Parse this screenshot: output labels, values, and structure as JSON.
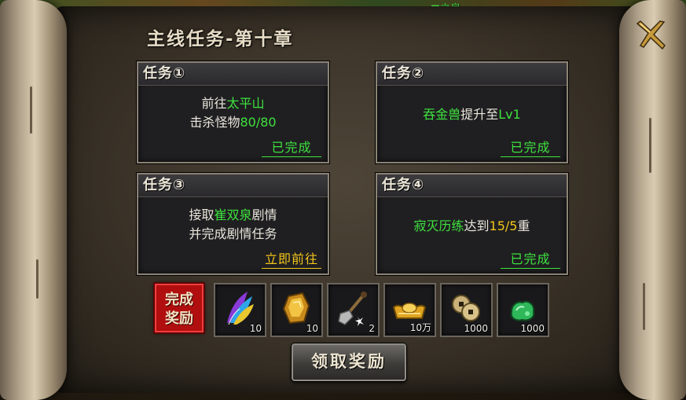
{
  "window": {
    "title": "主线任务-第十章",
    "top_text": "■之泉"
  },
  "quests": [
    {
      "title": "任务①",
      "line1_a": "前往",
      "line1_b": "太平山",
      "line2_a": "击杀怪物",
      "line2_b": "80/80",
      "status": "已完成"
    },
    {
      "title": "任务②",
      "line1_a": "吞金兽",
      "line1_b": "提升至",
      "line1_c": "Lv1",
      "status": "已完成"
    },
    {
      "title": "任务③",
      "line1_a": "接取",
      "line1_b": "崔双泉",
      "line1_c": "剧情",
      "line2_a": "并完成剧情任务",
      "status": "立即前往"
    },
    {
      "title": "任务④",
      "line1_a": "寂灭历练",
      "line1_b": "达到",
      "line1_c": "15/5",
      "line1_d": "重",
      "status": "已完成"
    }
  ],
  "rewards": {
    "badge_line1": "完成",
    "badge_line2": "奖励",
    "items": [
      {
        "icon": "feather-icon",
        "qty": "10"
      },
      {
        "icon": "gold-ore-icon",
        "qty": "10"
      },
      {
        "icon": "shovel-icon",
        "qty": "2"
      },
      {
        "icon": "gold-ingot-icon",
        "qty": "10万"
      },
      {
        "icon": "coin-stack-icon",
        "qty": "1000"
      },
      {
        "icon": "jade-icon",
        "qty": "1000"
      }
    ]
  },
  "claim_button": "领取奖励",
  "colors": {
    "highlight_green": "#3ee23e",
    "highlight_yellow": "#f2c51a",
    "badge_red": "#b10f0f"
  }
}
